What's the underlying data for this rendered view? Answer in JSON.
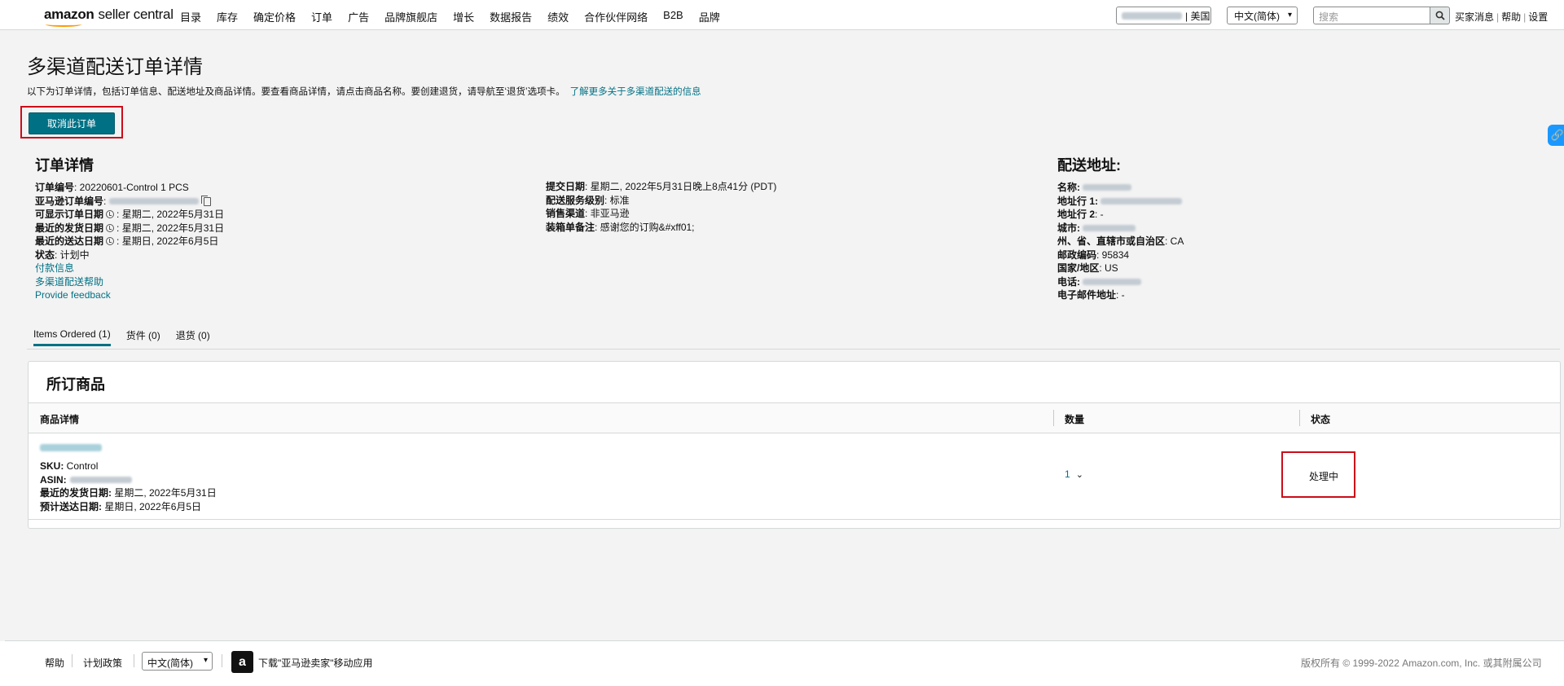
{
  "logo": {
    "bold": "amazon",
    "rest": "seller central"
  },
  "nav": {
    "items": [
      "目录",
      "库存",
      "确定价格",
      "订单",
      "广告",
      "品牌旗舰店",
      "增长",
      "数据报告",
      "绩效",
      "合作伙伴网络",
      "B2B",
      "品牌"
    ]
  },
  "account": {
    "marketplace": "| 美国"
  },
  "language": {
    "selected": "中文(简体)"
  },
  "search": {
    "placeholder": "搜索"
  },
  "top_links": {
    "messages": "买家消息",
    "help": "帮助",
    "settings": "设置"
  },
  "page": {
    "title": "多渠道配送订单详情",
    "intro": "以下为订单详情，包括订单信息、配送地址及商品详情。要查看商品详情，请点击商品名称。要创建退货，请导航至‘退货’选项卡。",
    "intro_link": "了解更多关于多渠道配送的信息",
    "cancel_button": "取消此订单"
  },
  "order_details": {
    "heading": "订单详情",
    "order_id_label": "订单编号",
    "order_id": ": 20220601-Control 1 PCS",
    "amazon_id_label": "亚马逊订单编号",
    "display_date_label": "可显示订单日期",
    "display_date": "星期二, 2022年5月31日",
    "latest_ship_label": "最近的发货日期",
    "latest_ship": "星期二, 2022年5月31日",
    "latest_delivery_label": "最近的送达日期",
    "latest_delivery": "星期日, 2022年6月5日",
    "status_label": "状态",
    "status": ": 计划中",
    "links": [
      "付款信息",
      "多渠道配送帮助",
      "Provide feedback"
    ]
  },
  "order_meta": {
    "submit_label": "提交日期",
    "submit_value": ": 星期二, 2022年5月31日晚上8点41分 (PDT)",
    "service_label": "配送服务级别",
    "service_value": ": 标准",
    "channel_label": "销售渠道",
    "channel_value": ": 非亚马逊",
    "packing_label": "装箱单备注",
    "packing_value": ": 感谢您的订购&#xff01;"
  },
  "shipping": {
    "heading": "配送地址:",
    "name_label": "名称:",
    "line1_label": "地址行 1:",
    "line2_label": "地址行 2",
    "line2_value": ": -",
    "city_label": "城市:",
    "state_label": "州、省、直辖市或自治区",
    "state_value": ": CA",
    "zip_label": "邮政编码",
    "zip_value": ": 95834",
    "country_label": "国家/地区",
    "country_value": ": US",
    "phone_label": "电话:",
    "email_label": "电子邮件地址",
    "email_value": ": -"
  },
  "tabs": [
    {
      "label": "Items Ordered (1)",
      "active": true
    },
    {
      "label": "货件 (0)",
      "active": false
    },
    {
      "label": "退货 (0)",
      "active": false
    }
  ],
  "items": {
    "title": "所订商品",
    "columns": [
      "商品详情",
      "数量",
      "状态"
    ],
    "row": {
      "sku_label": "SKU:",
      "sku": " Control",
      "asin_label": "ASIN:",
      "ship_label": "最近的发货日期:",
      "ship": " 星期二, 2022年5月31日",
      "delivery_label": "预计送达日期:",
      "delivery": " 星期日, 2022年6月5日",
      "quantity": "1",
      "status": "处理中"
    }
  },
  "footer": {
    "help": "帮助",
    "policy": "计划政策",
    "language": "中文(简体)",
    "app": "下载\"亚马逊卖家\"移动应用",
    "copyright": "版权所有 © 1999-2022 Amazon.com, Inc. 或其附属公司"
  }
}
